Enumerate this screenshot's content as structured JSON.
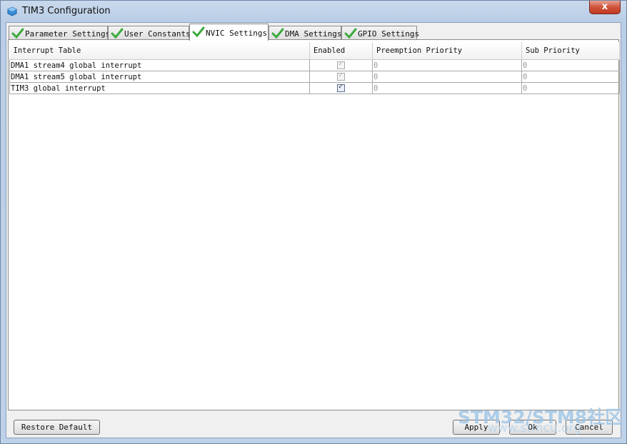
{
  "window": {
    "title": "TIM3 Configuration",
    "close_label": "x"
  },
  "tabs": [
    {
      "label": "Parameter Settings",
      "active": false
    },
    {
      "label": "User Constants",
      "active": false
    },
    {
      "label": "NVIC Settings",
      "active": true
    },
    {
      "label": "DMA Settings",
      "active": false
    },
    {
      "label": "GPIO Settings",
      "active": false
    }
  ],
  "table": {
    "headers": [
      "Interrupt Table",
      "Enabled",
      "Preemption Priority",
      "Sub Priority"
    ],
    "rows": [
      {
        "name": "DMA1 stream4 global interrupt",
        "enabled": true,
        "locked": true,
        "preemption": "0",
        "sub": "0"
      },
      {
        "name": "DMA1 stream5 global interrupt",
        "enabled": true,
        "locked": true,
        "preemption": "0",
        "sub": "0"
      },
      {
        "name": "TIM3 global interrupt",
        "enabled": true,
        "locked": false,
        "preemption": "0",
        "sub": "0"
      }
    ]
  },
  "buttons": {
    "restore": "Restore Default",
    "apply": "Apply",
    "ok": "Ok",
    "cancel": "Cancel"
  },
  "watermark": {
    "line1": "STM32/STM8社区",
    "line2": "www.stmcu.org"
  }
}
